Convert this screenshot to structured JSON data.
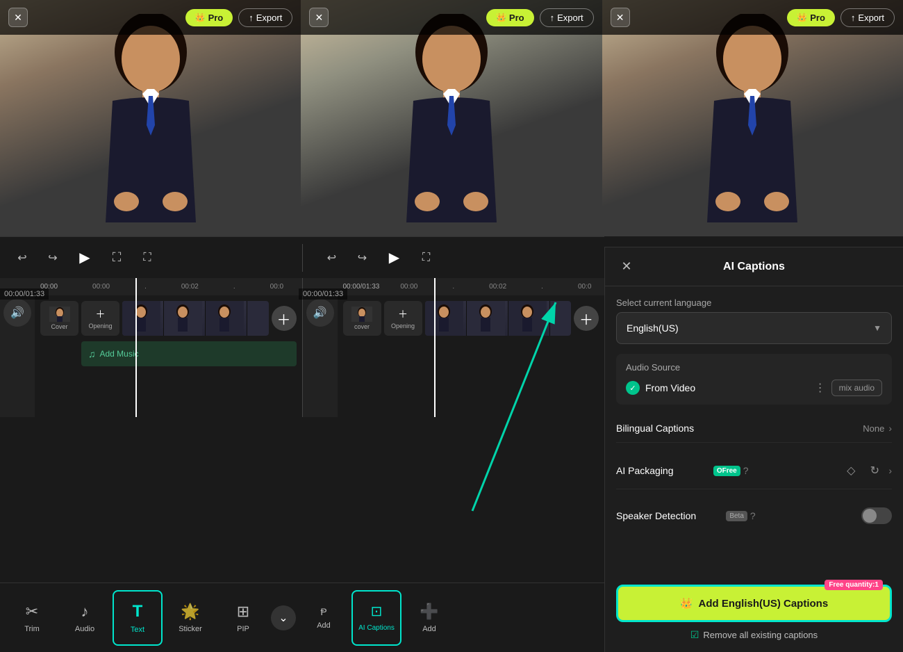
{
  "panels": [
    {
      "id": "panel-1",
      "pro_label": "Pro",
      "export_label": "Export",
      "time": "00:00/01:33",
      "timestamps": [
        "00:00",
        "00:02",
        "00:0"
      ]
    },
    {
      "id": "panel-2",
      "pro_label": "Pro",
      "export_label": "Export",
      "time": "00:00/01:33",
      "timestamps": [
        "00:00",
        "00:02",
        "00:0"
      ]
    },
    {
      "id": "panel-3",
      "pro_label": "Pro",
      "export_label": "Export",
      "time": "",
      "timestamps": []
    }
  ],
  "toolbar": {
    "items": [
      {
        "id": "trim",
        "label": "Trim",
        "icon": "✂"
      },
      {
        "id": "audio",
        "label": "Audio",
        "icon": "♪"
      },
      {
        "id": "text",
        "label": "Text",
        "icon": "T"
      },
      {
        "id": "sticker",
        "label": "Sticker",
        "icon": "●"
      },
      {
        "id": "pip",
        "label": "PIP",
        "icon": "⊞"
      },
      {
        "id": "add",
        "label": "Add",
        "icon": "Ᵽ"
      },
      {
        "id": "ai-captions",
        "label": "AI Captions",
        "icon": "⊡"
      },
      {
        "id": "add2",
        "label": "Add",
        "icon": "+"
      }
    ]
  },
  "timeline": {
    "tracks": [
      {
        "label": "Cover",
        "sublabel": "Opening"
      }
    ],
    "music_label": "Add Music"
  },
  "ai_captions_panel": {
    "title": "AI Captions",
    "close_label": "×",
    "language_label": "Select current language",
    "language_value": "English(US)",
    "audio_source": {
      "label": "Audio Source",
      "from_video_label": "From Video",
      "btn_label": "mix audio"
    },
    "bilingual_captions": {
      "label": "Bilingual Captions",
      "value": "None"
    },
    "ai_packaging": {
      "label": "AI Packaging",
      "badge_free": "Free",
      "badge_label": "OFree"
    },
    "speaker_detection": {
      "label": "Speaker Detection",
      "badge_beta": "Beta"
    },
    "add_btn_label": "Add English(US) Captions",
    "free_qty_label": "Free quantity:1",
    "remove_label": "Remove all existing captions"
  }
}
